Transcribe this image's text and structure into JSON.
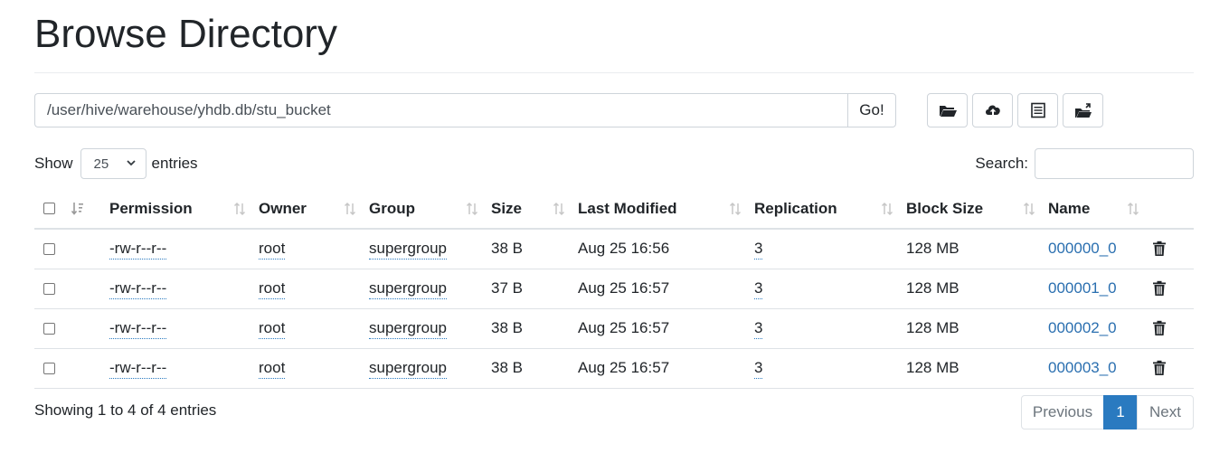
{
  "title": "Browse Directory",
  "path": {
    "value": "/user/hive/warehouse/yhdb.db/stu_bucket",
    "go_label": "Go!"
  },
  "toolbar": {
    "icons": [
      "folder-open-icon",
      "cloud-upload-icon",
      "list-alt-icon",
      "folder-move-icon"
    ]
  },
  "length": {
    "show_label": "Show",
    "value": "25",
    "entries_label": "entries"
  },
  "search": {
    "label": "Search:",
    "value": ""
  },
  "table": {
    "columns": [
      "Permission",
      "Owner",
      "Group",
      "Size",
      "Last Modified",
      "Replication",
      "Block Size",
      "Name"
    ],
    "rows": [
      {
        "permission": "-rw-r--r--",
        "owner": "root",
        "group": "supergroup",
        "size": "38 B",
        "modified": "Aug 25 16:56",
        "replication": "3",
        "block_size": "128 MB",
        "name": "000000_0"
      },
      {
        "permission": "-rw-r--r--",
        "owner": "root",
        "group": "supergroup",
        "size": "37 B",
        "modified": "Aug 25 16:57",
        "replication": "3",
        "block_size": "128 MB",
        "name": "000001_0"
      },
      {
        "permission": "-rw-r--r--",
        "owner": "root",
        "group": "supergroup",
        "size": "38 B",
        "modified": "Aug 25 16:57",
        "replication": "3",
        "block_size": "128 MB",
        "name": "000002_0"
      },
      {
        "permission": "-rw-r--r--",
        "owner": "root",
        "group": "supergroup",
        "size": "38 B",
        "modified": "Aug 25 16:57",
        "replication": "3",
        "block_size": "128 MB",
        "name": "000003_0"
      }
    ]
  },
  "footer": {
    "info": "Showing 1 to 4 of 4 entries",
    "previous": "Previous",
    "current_page": "1",
    "next": "Next"
  },
  "colors": {
    "accent": "#2a7ac0",
    "link": "#2a6fb0",
    "border": "#dee2e6"
  }
}
